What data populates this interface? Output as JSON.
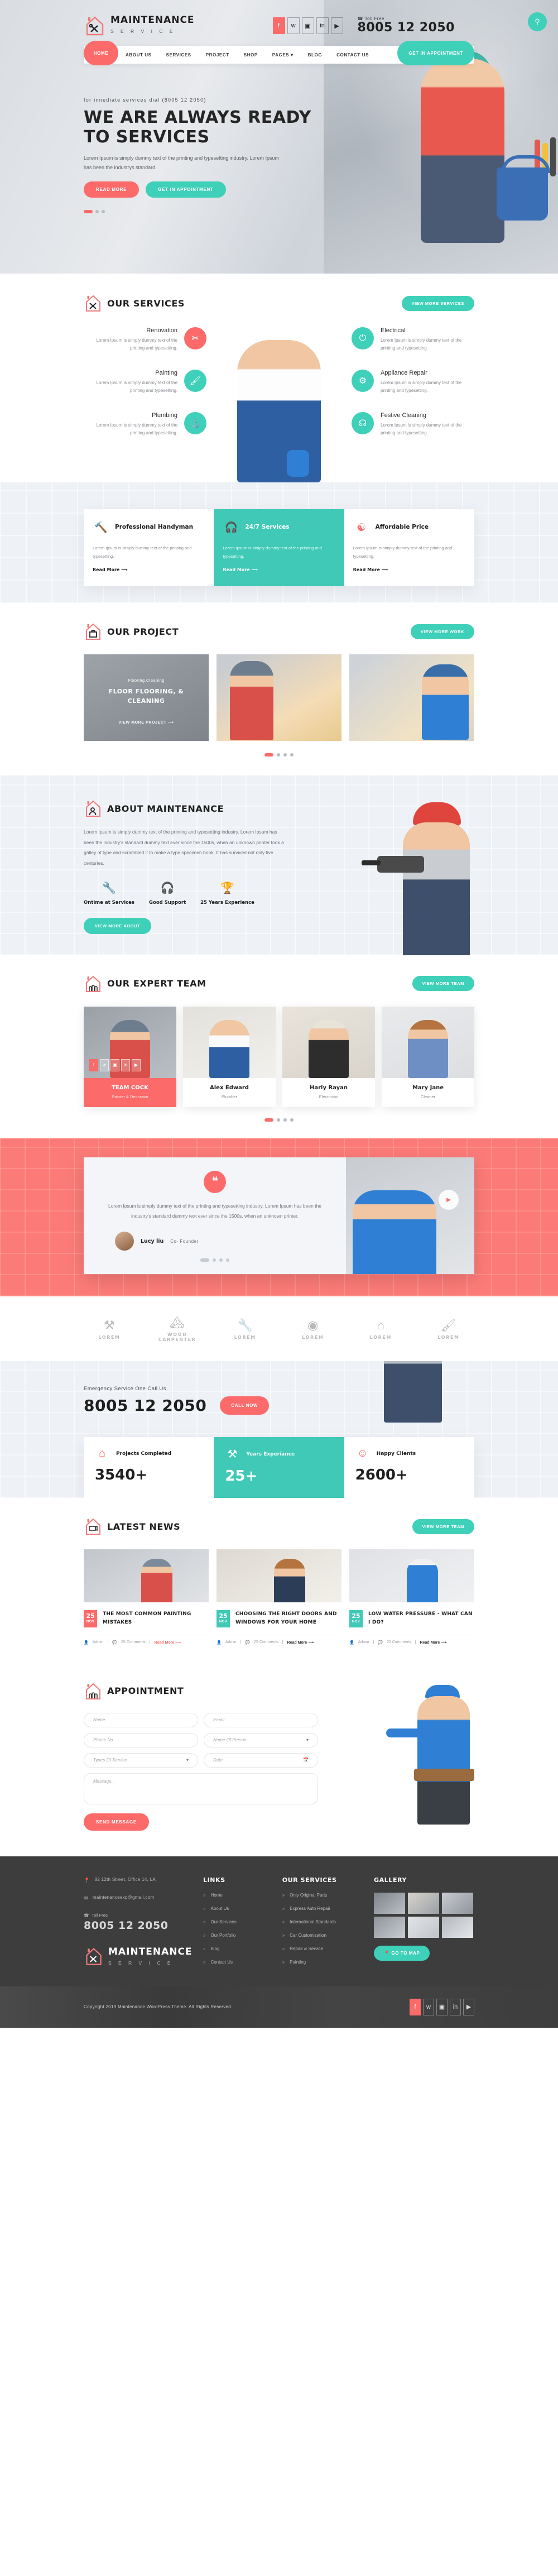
{
  "brand": {
    "name": "MAINTENANCE",
    "tagline": "S E R V I C E"
  },
  "colors": {
    "red": "#fc6a6a",
    "teal": "#3fd0b9",
    "dark": "#3d3d3d"
  },
  "header": {
    "toll_label": "Toll Free",
    "phone": "8005 12 2050",
    "search_icon": "search-icon",
    "social": [
      "facebook",
      "twitter",
      "instagram",
      "linkedin",
      "youtube"
    ],
    "nav": [
      "HOME",
      "ABOUT US",
      "SERVICES",
      "PROJECT",
      "SHOP",
      "PAGES",
      "BLOG",
      "CONTACT US"
    ],
    "cta": "GET IN APPOINTMENT"
  },
  "hero": {
    "pre": "for innediate services dial (8005 12 2050)",
    "title": "WE ARE ALWAYS READY TO SERVICES",
    "desc": "Lorem Ipsum is simply dummy text of the printing and typesetting industry. Lorem Ipsum has been the industrys standard.",
    "btn_primary": "READ MORE",
    "btn_secondary": "GET IN APPOINTMENT"
  },
  "services": {
    "title": "OUR SERVICES",
    "button": "VIEW MORE SERVICES",
    "left": [
      {
        "name": "Renovation",
        "desc": "Lorem Ipsum is simply dummy text of the printing and typesetting.",
        "icon": "tools-icon",
        "color": "red"
      },
      {
        "name": "Painting",
        "desc": "Lorem Ipsum is simply dummy text of the printing and typesetting.",
        "icon": "paint-brush-icon",
        "color": "teal"
      },
      {
        "name": "Plumbing",
        "desc": "Lorem Ipsum is simply dummy text of the printing and typesetting.",
        "icon": "faucet-icon",
        "color": "teal"
      }
    ],
    "right": [
      {
        "name": "Electrical",
        "desc": "Lorem Ipsum is simply dummy text of the printing and typesetting.",
        "icon": "plug-icon",
        "color": "teal"
      },
      {
        "name": "Appliance Repair",
        "desc": "Lorem Ipsum is simply dummy text of the printing and typesetting.",
        "icon": "gear-icon",
        "color": "teal"
      },
      {
        "name": "Festive Cleaning",
        "desc": "Lorem Ipsum is simply dummy text of the printing and typesetting.",
        "icon": "vacuum-icon",
        "color": "teal"
      }
    ]
  },
  "features": [
    {
      "title": "Professional Handyman",
      "desc": "Lorem Ipsum is simply dummy text of the printing and typesetting.",
      "link": "Read More",
      "icon": "drill-icon",
      "highlight": false
    },
    {
      "title": "24/7 Services",
      "desc": "Lorem Ipsum is simply dummy text of the printing and typesetting.",
      "link": "Read More",
      "icon": "headset-icon",
      "highlight": true
    },
    {
      "title": "Affordable Price",
      "desc": "Lorem Ipsum is simply dummy text of the printing and typesetting.",
      "link": "Read More",
      "icon": "hand-coin-icon",
      "highlight": false
    }
  ],
  "project": {
    "title": "OUR PROJECT",
    "button": "VIEW MORE WORK",
    "card": {
      "category": "Flooring,Cleaning",
      "title": "FLOOR FLOORING, & CLEANING",
      "link": "VIEW MORE PROJECT"
    }
  },
  "about": {
    "title": "ABOUT MAINTENANCE",
    "desc": "Lorem Ipsum is simply dummy text of the printing and typesetting industry. Lorem Ipsum has been the industry's standard dummy text ever since the 1500s, when an unknown printer took a galley of type and scrambled it to make a type specimen book. It has survived not only five centuries.",
    "features": [
      {
        "label": "Ontime at Services",
        "icon": "screwdriver-tools-icon"
      },
      {
        "label": "Good Support",
        "icon": "headset-icon"
      },
      {
        "label": "25 Years Experience",
        "icon": "trophy-icon"
      }
    ],
    "button": "VIEW MORE ABOUT"
  },
  "team": {
    "title": "OUR EXPERT TEAM",
    "button": "VIEW MORE TEAM",
    "members": [
      {
        "name": "TEAM COCK",
        "role": "Painter & Decorator",
        "active": true
      },
      {
        "name": "Alex Edward",
        "role": "Plumber",
        "active": false
      },
      {
        "name": "Harly Rayan",
        "role": "Electrician",
        "active": false
      },
      {
        "name": "Mary Jane",
        "role": "Cleaner",
        "active": false
      }
    ]
  },
  "testimonial": {
    "quote_icon": "quote-icon",
    "text": "Lorem Ipsum is simply dummy text of the printing and typesetting industry. Lorem Ipsum has been the industry's standard dummy text ever since the 1500s, when an unknown printer.",
    "author": "Lucy liu",
    "role": "Co- Founder",
    "play_icon": "play-icon"
  },
  "brands": [
    {
      "label": "LOREM",
      "icon": "tools-icon"
    },
    {
      "label": "WOOD CARPENTER",
      "icon": "wood-icon"
    },
    {
      "label": "LOREM",
      "icon": "wrench-icon"
    },
    {
      "label": "LOREM",
      "icon": "badge-icon"
    },
    {
      "label": "LOREM",
      "icon": "house-icon"
    },
    {
      "label": "LOREM",
      "icon": "roller-icon"
    }
  ],
  "call": {
    "label": "Emergency Service One Call Us",
    "phone": "8005 12 2050",
    "button": "CALL NOW"
  },
  "counters": [
    {
      "label": "Projects Completed",
      "value": "3540+",
      "icon": "house-icon",
      "highlight": false
    },
    {
      "label": "Years Experiance",
      "value": "25+",
      "icon": "tools-icon",
      "highlight": true
    },
    {
      "label": "Happy Clients",
      "value": "2600+",
      "icon": "smiley-icon",
      "highlight": false
    }
  ],
  "news": {
    "title": "LATEST NEWS",
    "button": "VIEW MORE TEAM",
    "posts": [
      {
        "day": "25",
        "month": "NOV",
        "title": "THE MOST COMMON PAINTING MISTAKES",
        "author": "Admin",
        "comments": "25 Comments",
        "link": "Read More",
        "highlight": true
      },
      {
        "day": "25",
        "month": "NOV",
        "title": "CHOOSING THE RIGHT DOORS AND WINDOWS FOR YOUR HOME",
        "author": "Admin",
        "comments": "25 Comments",
        "link": "Read More",
        "highlight": false
      },
      {
        "day": "25",
        "month": "NOV",
        "title": "LOW WATER PRESSURE - WHAT CAN I DO?",
        "author": "Admin",
        "comments": "25 Comments",
        "link": "Read More",
        "highlight": false
      }
    ]
  },
  "appointment": {
    "title": "APPOINTMENT",
    "fields": [
      {
        "placeholder": "Name",
        "icon": ""
      },
      {
        "placeholder": "Email",
        "icon": ""
      },
      {
        "placeholder": "Phone No",
        "icon": ""
      },
      {
        "placeholder": "Name Of Person",
        "icon": "chevron-down-icon"
      },
      {
        "placeholder": "Types Of Service",
        "icon": "chevron-down-icon"
      },
      {
        "placeholder": "Date",
        "icon": "calendar-icon"
      }
    ],
    "message_placeholder": "Message...",
    "submit": "SEND MESSAGE"
  },
  "footer": {
    "address": "82 12th Street, Office 14, LA",
    "email": "maintenanceexp@gmail.com",
    "toll_label": "Toll Free",
    "phone": "8005 12 2050",
    "links_title": "LINKS",
    "links": [
      "Home",
      "About Us",
      "Our Services",
      "Our Portfolio",
      "Blog",
      "Contact Us"
    ],
    "services_title": "OUR SERVICES",
    "services": [
      "Only Original Parts",
      "Express Auto Repair",
      "International Standards",
      "Car Customization",
      "Repair & Service",
      "Painting"
    ],
    "gallery_title": "GALLERY",
    "map_button": "GO TO MAP",
    "copyright": "Copyright 2019 Maintenance WordPress Theme. All Rights Reserved.",
    "social": [
      "facebook",
      "twitter",
      "instagram",
      "linkedin",
      "youtube"
    ]
  }
}
